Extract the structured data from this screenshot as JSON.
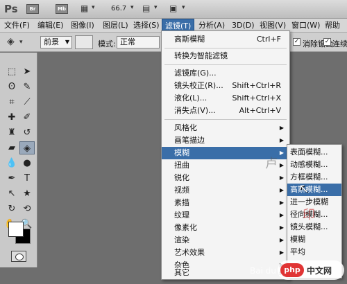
{
  "app": {
    "logo": "Ps",
    "bridge_chip": "Br",
    "minibridge_chip": "Mb",
    "zoom": "66.7"
  },
  "menubar": [
    "文件(F)",
    "编辑(E)",
    "图像(I)",
    "图层(L)",
    "选择(S)",
    "滤镜(T)",
    "分析(A)",
    "3D(D)",
    "视图(V)",
    "窗口(W)",
    "帮助"
  ],
  "options": {
    "preset": "前景",
    "mode_label": "模式:",
    "mode_value": "正常",
    "antialias_label": "消除锯齿",
    "contiguous_label": "连续"
  },
  "filter_menu": {
    "items": [
      {
        "label": "高斯模糊",
        "shortcut": "Ctrl+F"
      },
      {
        "label": "转换为智能滤镜"
      },
      {
        "label": "滤镜库(G)..."
      },
      {
        "label": "镜头校正(R)...",
        "shortcut": "Shift+Ctrl+R"
      },
      {
        "label": "液化(L)...",
        "shortcut": "Shift+Ctrl+X"
      },
      {
        "label": "消失点(V)...",
        "shortcut": "Alt+Ctrl+V"
      },
      {
        "label": "风格化",
        "submenu": true
      },
      {
        "label": "画笔描边",
        "submenu": true
      },
      {
        "label": "模糊",
        "submenu": true,
        "highlighted": true
      },
      {
        "label": "扭曲",
        "submenu": true
      },
      {
        "label": "锐化",
        "submenu": true
      },
      {
        "label": "视频",
        "submenu": true
      },
      {
        "label": "素描",
        "submenu": true
      },
      {
        "label": "纹理",
        "submenu": true
      },
      {
        "label": "像素化",
        "submenu": true
      },
      {
        "label": "渲染",
        "submenu": true
      },
      {
        "label": "艺术效果",
        "submenu": true
      },
      {
        "label": "杂色",
        "submenu": true
      },
      {
        "label": "其它",
        "submenu": true
      }
    ]
  },
  "blur_submenu": {
    "items": [
      {
        "label": "表面模糊..."
      },
      {
        "label": "动感模糊..."
      },
      {
        "label": "方框模糊..."
      },
      {
        "label": "高斯模糊...",
        "highlighted": true
      },
      {
        "label": "进一步模糊"
      },
      {
        "label": "径向模糊..."
      },
      {
        "label": "镜头模糊..."
      },
      {
        "label": "模糊"
      },
      {
        "label": "平均"
      }
    ]
  },
  "watermarks": {
    "site": "php 中文网",
    "php": "php",
    "cn": "中文网",
    "baidu": "Bai du 经验"
  },
  "colors": {
    "highlight": "#3a6ea8",
    "menu_bg": "#f4f4f4",
    "workspace": "#6e6e6e"
  }
}
